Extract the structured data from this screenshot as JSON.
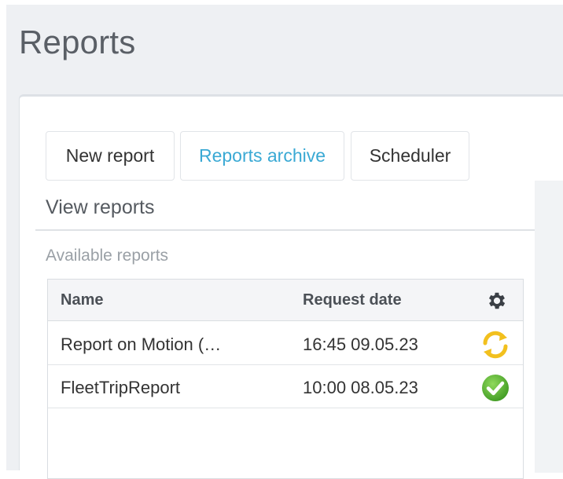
{
  "page": {
    "title": "Reports"
  },
  "tabs": [
    {
      "label": "New report",
      "active": false
    },
    {
      "label": "Reports archive",
      "active": true
    },
    {
      "label": "Scheduler",
      "active": false
    }
  ],
  "view": {
    "title": "View reports",
    "subtitle": "Available reports"
  },
  "table": {
    "columns": {
      "name": "Name",
      "date": "Request date",
      "settings_icon": "gear-icon"
    },
    "rows": [
      {
        "name": "Report on Motion (…",
        "date": "16:45 09.05.23",
        "status_icon": "sync-icon",
        "status": "in-progress"
      },
      {
        "name": "FleetTripReport",
        "date": "10:00 08.05.23",
        "status_icon": "check-circle-icon",
        "status": "completed"
      }
    ]
  },
  "colors": {
    "accent": "#3aa9d4",
    "in_progress": "#f2c01e",
    "completed": "#5cb82f"
  }
}
